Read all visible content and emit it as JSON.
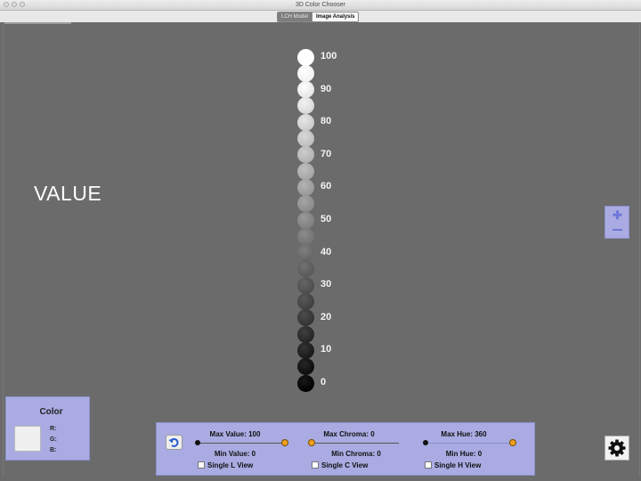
{
  "window": {
    "title": "3D Color Chooser"
  },
  "tabs": [
    {
      "label": "LCH Model",
      "active": true
    },
    {
      "label": "Image Analysis",
      "active": false
    }
  ],
  "view": {
    "axis_title": "VALUE",
    "value_scale": {
      "labels": [
        "100",
        "90",
        "80",
        "70",
        "60",
        "50",
        "40",
        "30",
        "20",
        "10",
        "0"
      ],
      "values": [
        100,
        95,
        90,
        85,
        80,
        75,
        70,
        65,
        60,
        55,
        50,
        45,
        40,
        35,
        30,
        25,
        20,
        15,
        10,
        5,
        0
      ]
    }
  },
  "zoom": {
    "in_icon": "plus-icon",
    "out_icon": "minus-icon"
  },
  "color_panel": {
    "label": "Color",
    "swatch_color": "#f0f0f0",
    "r_label": "R:",
    "g_label": "G:",
    "b_label": "B:"
  },
  "controls": {
    "reset_icon": "undo-arrow-icon",
    "value": {
      "max_label": "Max Value: 100",
      "min_label": "Min Value: 0",
      "single_label": "Single L View"
    },
    "chroma": {
      "max_label": "Max Chroma: 0",
      "min_label": "Min Chroma: 0",
      "single_label": "Single C View"
    },
    "hue": {
      "max_label": "Max Hue: 360",
      "min_label": "Min Hue: 0",
      "single_label": "Single H View"
    }
  },
  "settings": {
    "icon": "gear-icon"
  },
  "colors": {
    "panel": "#a9abe2",
    "canvas": "#6b6b6b",
    "knob": "#f0a01e"
  }
}
